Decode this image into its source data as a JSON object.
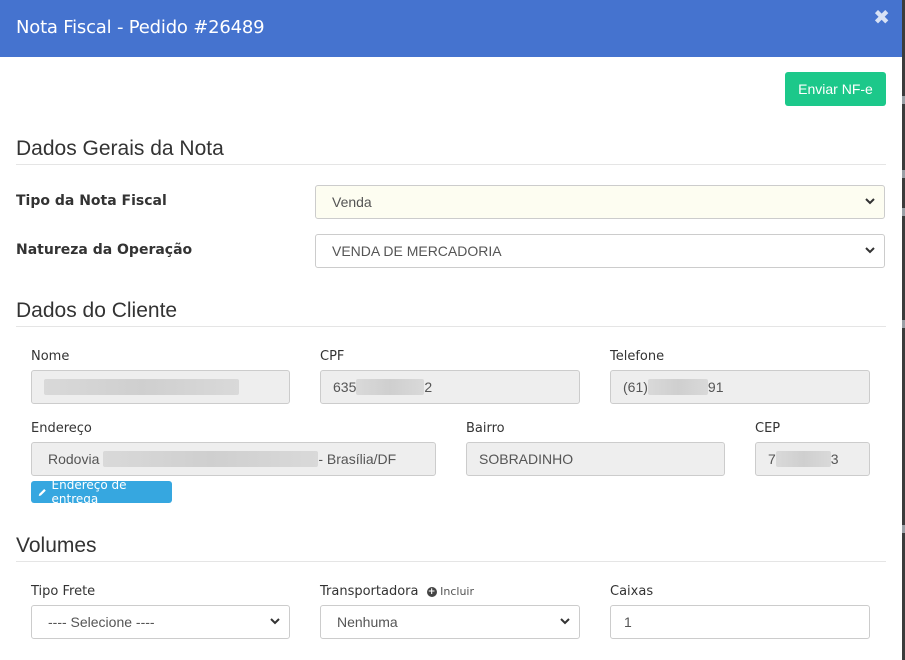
{
  "modal": {
    "title": "Nota Fiscal - Pedido #26489",
    "close_symbol": "✖"
  },
  "actions": {
    "send_label": "Enviar NF-e"
  },
  "sections": {
    "general": "Dados Gerais da Nota",
    "client": "Dados do Cliente",
    "volumes": "Volumes"
  },
  "general": {
    "tipo_label": "Tipo da Nota Fiscal",
    "tipo_value": "Venda",
    "natureza_label": "Natureza da Operação",
    "natureza_value": "VENDA DE MERCADORIA"
  },
  "client": {
    "nome_label": "Nome",
    "cpf_label": "CPF",
    "cpf_prefix": "635",
    "cpf_suffix": "2",
    "telefone_label": "Telefone",
    "telefone_prefix": "(61)",
    "telefone_suffix": "91",
    "endereco_label": "Endereço",
    "endereco_prefix": "Rodovia",
    "endereco_suffix": "- Brasília/DF",
    "bairro_label": "Bairro",
    "bairro_value": "SOBRADINHO",
    "cep_label": "CEP",
    "cep_prefix": "7",
    "cep_suffix": "3",
    "delivery_button": "Endereço de entrega"
  },
  "volumes": {
    "frete_label": "Tipo Frete",
    "frete_value": "---- Selecione ----",
    "transportadora_label": "Transportadora",
    "incluir_label": "Incluir",
    "transportadora_value": "Nenhuma",
    "caixas_label": "Caixas",
    "caixas_value": "1"
  },
  "colors": {
    "header": "#4573cf",
    "send_button": "#1cc88a",
    "delivery_button": "#36a7e0"
  }
}
